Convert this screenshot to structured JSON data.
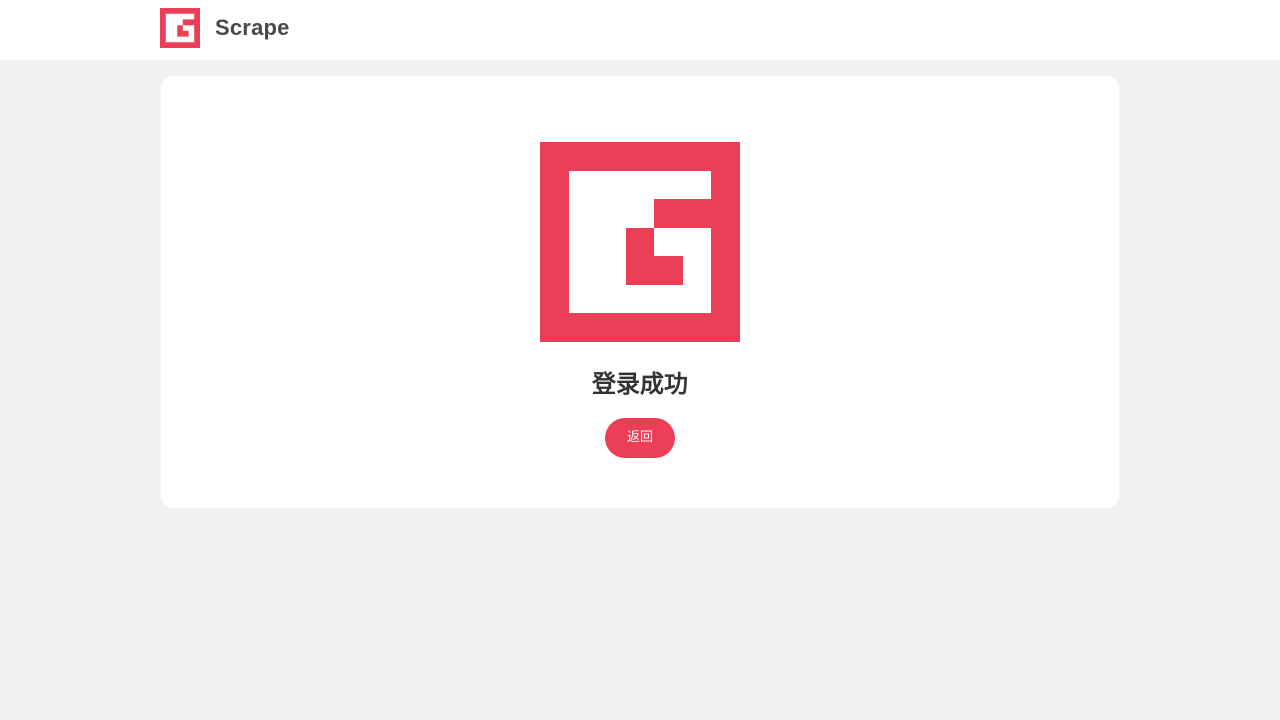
{
  "header": {
    "brand_name": "Scrape",
    "logo_icon": "scrape-g-logo-icon"
  },
  "main": {
    "logo_icon": "scrape-g-logo-icon",
    "status_text": "登录成功",
    "back_button_label": "返回"
  },
  "colors": {
    "brand": "#ec3e57",
    "page_background": "#f1f1f1",
    "card_background": "#ffffff",
    "text_dark": "#333333",
    "brand_text": "#4a4a4a"
  }
}
